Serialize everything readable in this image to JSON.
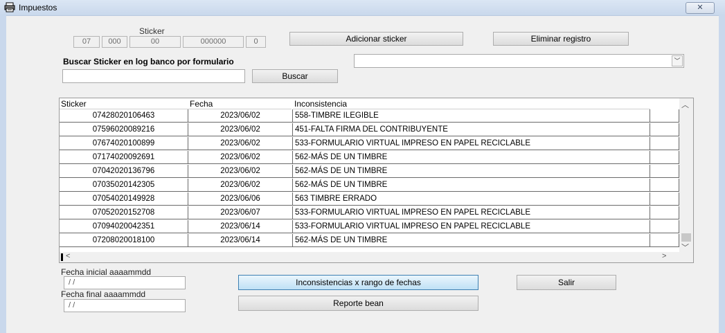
{
  "window": {
    "title": "Impuestos",
    "close_glyph": "✕"
  },
  "sticker": {
    "label": "Sticker",
    "segments": [
      "07",
      "000",
      "00",
      "000000",
      "0"
    ]
  },
  "buttons": {
    "add_sticker": "Adicionar sticker",
    "delete_record": "Eliminar registro",
    "search": "Buscar",
    "range_report": "Inconsistencias x rango de fechas",
    "exit": "Salir",
    "bean_report": "Reporte bean"
  },
  "search": {
    "label": "Buscar Sticker en log banco por formulario",
    "value": "",
    "combo_value": ""
  },
  "table": {
    "columns": [
      "Sticker",
      "Fecha",
      "Inconsistencia"
    ],
    "rows": [
      [
        "07428020106463",
        "2023/06/02",
        "558-TIMBRE ILEGIBLE"
      ],
      [
        "07596020089216",
        "2023/06/02",
        "451-FALTA FIRMA DEL CONTRIBUYENTE"
      ],
      [
        "07674020100899",
        "2023/06/02",
        "533-FORMULARIO VIRTUAL IMPRESO EN PAPEL RECICLABLE"
      ],
      [
        "07174020092691",
        "2023/06/02",
        "562-MÁS DE UN TIMBRE"
      ],
      [
        "07042020136796",
        "2023/06/02",
        "562-MÁS DE UN TIMBRE"
      ],
      [
        "07035020142305",
        "2023/06/02",
        "562-MÁS DE UN TIMBRE"
      ],
      [
        "07054020149928",
        "2023/06/06",
        "563 TIMBRE ERRADO"
      ],
      [
        "07052020152708",
        "2023/06/07",
        "533-FORMULARIO VIRTUAL IMPRESO EN PAPEL RECICLABLE"
      ],
      [
        "07094020042351",
        "2023/06/14",
        "533-FORMULARIO VIRTUAL IMPRESO EN PAPEL RECICLABLE"
      ],
      [
        "07208020018100",
        "2023/06/14",
        "562-MÁS DE UN TIMBRE"
      ]
    ]
  },
  "dates": {
    "start_label": "Fecha inicial aaaammdd",
    "start_value": " / /",
    "end_label": "Fecha final aaaammdd",
    "end_value": " / /"
  },
  "icons": [
    "printer-app-icon",
    "close-icon",
    "dropdown-arrow-icon",
    "scroll-up-icon",
    "scroll-down-icon",
    "scroll-left-icon",
    "scroll-right-icon"
  ]
}
